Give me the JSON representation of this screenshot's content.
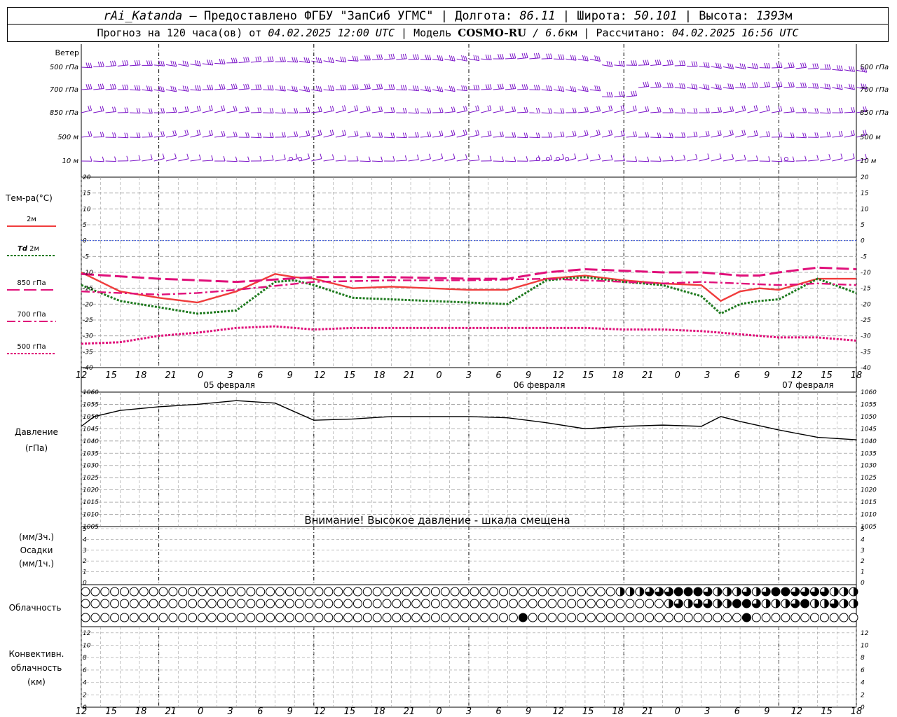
{
  "header": {
    "station": "rAi_Katanda",
    "dash": " — ",
    "provider": "Предоставлено ФГБУ \"ЗапСиб УГМС\"",
    "sep": " | ",
    "lon_label": "Долгота: ",
    "lon_value": "86.11",
    "lat_label": "Широта: ",
    "lat_value": "50.101",
    "alt_label": "Высота: ",
    "alt_value": "1393",
    "alt_unit": "м",
    "forecast_label": "Прогноз на 120 часа(ов) от ",
    "forecast_date": "04.02.2025 12:00 UTC",
    "model_label": "  | Модель ",
    "model_name": "COSMO-RU",
    "model_res": " / 6.6",
    "model_unit": "км",
    "calc_label": " | Рассчитано: ",
    "calc_date": "04.02.2025 16:56 UTC"
  },
  "colors": {
    "wind": "#7b14c8",
    "t2m": "#f03c3c",
    "td2m": "#1e7a1e",
    "t850": "#e0107a",
    "t700": "#e0107a",
    "t500": "#e0107a",
    "zero_line": "#3050e0",
    "pressure": "#000000",
    "grid": "#9a9a9a"
  },
  "time_axis": {
    "hour_labels": [
      "12",
      "15",
      "18",
      "21",
      "0",
      "3",
      "6",
      "9",
      "12",
      "15",
      "18",
      "21",
      "0",
      "3",
      "6",
      "9",
      "12",
      "15",
      "18",
      "21",
      "0",
      "3",
      "6",
      "9",
      "12",
      "15",
      "18"
    ],
    "day_labels": [
      "05 февраля",
      "06 февраля",
      "07 февраля"
    ]
  },
  "wind_panel": {
    "title": "Ветер",
    "levels": [
      "500 гПа",
      "700 гПа",
      "850 гПа",
      "500 м",
      "10 м"
    ]
  },
  "temp_panel": {
    "title": "Тем-ра(°C)",
    "legend": [
      {
        "key": "t2m",
        "label": "2м"
      },
      {
        "key": "td2m",
        "label_italic": "Td",
        "label": " 2м"
      },
      {
        "key": "t850",
        "label": "850 гПа"
      },
      {
        "key": "t700",
        "label": "700 гПа"
      },
      {
        "key": "t500",
        "label": "500 гПа"
      }
    ]
  },
  "pressure_panel": {
    "title1": "Давление",
    "title2": "(гПа)",
    "warning": "Внимание! Высокое давление - шкала смещена"
  },
  "precip_panel": {
    "title1": "(мм/3ч.)",
    "title2": "Осадки",
    "title3": "(мм/1ч.)"
  },
  "cloud_panel": {
    "title": "Облачность"
  },
  "conv_panel": {
    "title1": "Конвективн.",
    "title2": "облачность",
    "title3": "(км)"
  },
  "chart_data": [
    {
      "type": "line",
      "title": "Тем-ра(°C)",
      "x_hours_from_start": [
        0,
        3,
        6,
        9,
        12,
        15,
        18,
        21,
        24,
        27,
        30,
        33,
        36,
        39,
        42,
        45,
        48,
        51,
        54,
        57,
        60,
        63,
        66,
        69,
        72,
        75,
        78,
        81,
        84,
        87,
        90,
        93,
        96,
        99,
        102,
        105,
        108,
        111,
        114,
        117,
        120
      ],
      "x_tick_labels": [
        "12",
        "15",
        "18",
        "21",
        "0",
        "3",
        "6",
        "9",
        "12",
        "15",
        "18",
        "21",
        "0",
        "3",
        "6",
        "9",
        "12",
        "15",
        "18",
        "21",
        "0",
        "3",
        "6",
        "9",
        "12",
        "15",
        "18"
      ],
      "ylim": [
        -40,
        20
      ],
      "yticks": [
        -40,
        -35,
        -30,
        -25,
        -20,
        -15,
        -10,
        -5,
        0,
        5,
        10,
        15,
        20
      ],
      "grid": true,
      "series": [
        {
          "name": "2м",
          "x": [
            0,
            6,
            12,
            18,
            24,
            30,
            33,
            36,
            42,
            48,
            54,
            60,
            66,
            72,
            78,
            84,
            90,
            96,
            99,
            102,
            105,
            108,
            114,
            120
          ],
          "values": [
            -10,
            -16,
            -18,
            -19.5,
            -16,
            -10.5,
            -11.5,
            -12,
            -15,
            -14.5,
            -15,
            -15.5,
            -15.5,
            -12,
            -11,
            -12.5,
            -13.5,
            -14,
            -19,
            -16,
            -15,
            -15.5,
            -12,
            -12
          ]
        },
        {
          "name": "Td 2м",
          "x": [
            0,
            6,
            12,
            18,
            24,
            30,
            33,
            36,
            42,
            48,
            54,
            60,
            66,
            72,
            78,
            84,
            90,
            96,
            99,
            102,
            105,
            108,
            114,
            120
          ],
          "values": [
            -14,
            -19,
            -21,
            -23,
            -22,
            -13,
            -12.5,
            -14,
            -18,
            -18.5,
            -19,
            -19.5,
            -20,
            -12.5,
            -11.5,
            -13,
            -14,
            -17.5,
            -23,
            -20,
            -19,
            -18.5,
            -12,
            -16.5
          ]
        },
        {
          "name": "850 гПа",
          "x": [
            0,
            12,
            24,
            36,
            48,
            60,
            66,
            72,
            78,
            84,
            90,
            96,
            99,
            102,
            105,
            108,
            114,
            120
          ],
          "values": [
            -10.5,
            -12,
            -13,
            -11.5,
            -11.5,
            -12,
            -12,
            -10,
            -9,
            -9.5,
            -10,
            -10,
            -10.5,
            -11,
            -11,
            -10,
            -8.5,
            -9
          ]
        },
        {
          "name": "700 гПа",
          "x": [
            0,
            12,
            18,
            24,
            36,
            48,
            60,
            72,
            84,
            90,
            96,
            102,
            108,
            114,
            120
          ],
          "values": [
            -16,
            -17,
            -16.5,
            -15.5,
            -13,
            -12.5,
            -12.5,
            -12,
            -13,
            -13.5,
            -13,
            -13.5,
            -14,
            -13.5,
            -14
          ]
        },
        {
          "name": "500 гПа",
          "x": [
            0,
            6,
            12,
            18,
            24,
            30,
            36,
            42,
            48,
            54,
            60,
            66,
            72,
            78,
            84,
            90,
            96,
            102,
            108,
            114,
            120
          ],
          "values": [
            -32.5,
            -32,
            -30,
            -29,
            -27.5,
            -27,
            -28,
            -27.5,
            -27.5,
            -27.5,
            -27.5,
            -27.5,
            -27.5,
            -27.5,
            -28,
            -28,
            -28.5,
            -29.5,
            -30.5,
            -30.5,
            -31.5
          ]
        },
        {
          "name": "0°C",
          "x": [
            0,
            120
          ],
          "values": [
            0,
            0
          ]
        }
      ]
    },
    {
      "type": "line",
      "title": "Давление (гПа)",
      "ylim": [
        1005,
        1060
      ],
      "yticks": [
        1005,
        1010,
        1015,
        1020,
        1025,
        1030,
        1035,
        1040,
        1045,
        1050,
        1055,
        1060
      ],
      "grid": true,
      "series": [
        {
          "name": "Давление",
          "x": [
            0,
            2,
            6,
            12,
            18,
            24,
            30,
            33,
            36,
            42,
            48,
            54,
            60,
            66,
            72,
            78,
            84,
            90,
            96,
            99,
            102,
            108,
            114,
            120
          ],
          "values": [
            1046,
            1050,
            1052.5,
            1054,
            1055,
            1056.5,
            1055.5,
            1052,
            1048.5,
            1049,
            1050,
            1050,
            1050,
            1049.5,
            1047.5,
            1045,
            1046,
            1046.5,
            1046,
            1050,
            1048,
            1044.5,
            1041.5,
            1040.5
          ]
        }
      ]
    },
    {
      "type": "bar",
      "title": "Осадки (мм/3ч.) / (мм/1ч.)",
      "ylim": [
        0,
        5
      ],
      "yticks": [
        0,
        1,
        2,
        3,
        4,
        5
      ],
      "series": [
        {
          "name": "Осадки",
          "values": []
        }
      ]
    },
    {
      "type": "table",
      "title": "Облачность",
      "levels": 3,
      "columns": 70,
      "note": "cover fraction per column (0-1), top/mid/low rows",
      "rows": [
        [
          0,
          0,
          0,
          0,
          0,
          0,
          0,
          0,
          0,
          0,
          0,
          0,
          0,
          0,
          0,
          0,
          0,
          0,
          0,
          0,
          0,
          0,
          0,
          0,
          0,
          0,
          0,
          0,
          0,
          0,
          0,
          0,
          0,
          0,
          0,
          0,
          0,
          0,
          0,
          0,
          0,
          0,
          0,
          0,
          0,
          0,
          0,
          0,
          0,
          0,
          0,
          0,
          0,
          0,
          0,
          0.5,
          0.5,
          0.5,
          0.75,
          0.75,
          0.75,
          1,
          1,
          1,
          0.75,
          0.5,
          0.5,
          0.5,
          0.75,
          0.5,
          0.75,
          1,
          1,
          0.75,
          0.75,
          0.75,
          0.75,
          0.5,
          0.5,
          0.5
        ],
        [
          0,
          0,
          0,
          0,
          0,
          0,
          0,
          0,
          0,
          0,
          0,
          0,
          0,
          0,
          0,
          0,
          0,
          0,
          0,
          0,
          0,
          0,
          0,
          0,
          0,
          0,
          0,
          0,
          0,
          0,
          0,
          0,
          0,
          0,
          0,
          0,
          0,
          0,
          0,
          0,
          0,
          0,
          0,
          0,
          0,
          0,
          0,
          0,
          0,
          0,
          0,
          0,
          0,
          0,
          0,
          0,
          0,
          0,
          0,
          0,
          0.5,
          0.75,
          0.5,
          0.75,
          0.75,
          0.5,
          0.5,
          1,
          1,
          0.75,
          0.5,
          0.5,
          0.5,
          0.75,
          1,
          0.5,
          0.5,
          0.75,
          0.5,
          0.5,
          0.75
        ],
        [
          0,
          0,
          0,
          0,
          0,
          0,
          0,
          0,
          0,
          0,
          0,
          0,
          0,
          0,
          0,
          0,
          0,
          0,
          0,
          0,
          0,
          0,
          0,
          0,
          0,
          0,
          0,
          0,
          0,
          0,
          0,
          0,
          0,
          0,
          0,
          0,
          0,
          0,
          0,
          0,
          0,
          0,
          0,
          0,
          0,
          1,
          0,
          0,
          0,
          0,
          0,
          0,
          0,
          0,
          0,
          0,
          0,
          0,
          0,
          0,
          0,
          0,
          0,
          0,
          0,
          0,
          0,
          0,
          1,
          0,
          0,
          0,
          0,
          0,
          0,
          0,
          0,
          0,
          0,
          0
        ]
      ]
    },
    {
      "type": "bar",
      "title": "Конвективн. облачность (км)",
      "ylim": [
        0,
        13
      ],
      "yticks": [
        0,
        2,
        4,
        6,
        8,
        10,
        12
      ],
      "series": [
        {
          "name": "Конвективн. облачность",
          "values": []
        }
      ]
    }
  ]
}
